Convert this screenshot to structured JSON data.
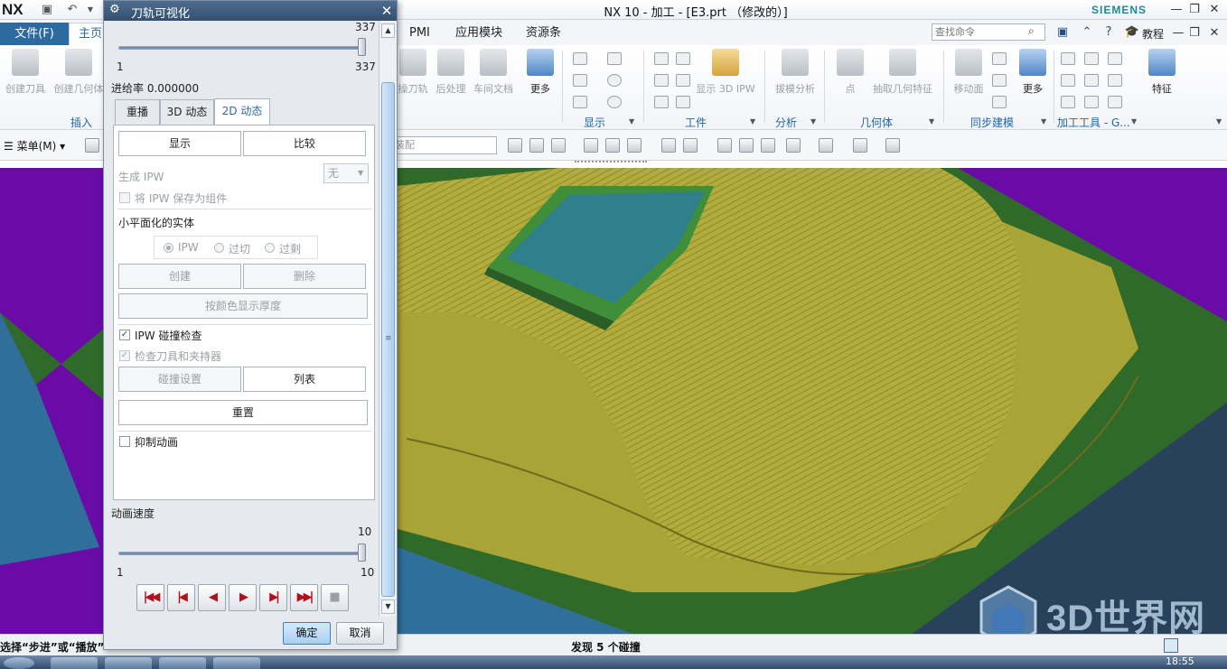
{
  "titlebar": {
    "logo": "NX",
    "title": "NX 10 - 加工 - [E3.prt （修改的）]",
    "brand": "SIEMENS",
    "window_controls": [
      "minimize-icon",
      "restore-icon",
      "close-icon"
    ]
  },
  "ribbon": {
    "file_tab": "文件(F)",
    "home_tab": "主页",
    "tabs": [
      "PMI",
      "应用模块",
      "资源条"
    ],
    "search_placeholder": "查找命令",
    "tutorial": "教程",
    "buttons": {
      "create_tool": "创建刀具",
      "create_geometry": "创建几何体",
      "tool_path": "操刀轨",
      "post_process": "后处理",
      "shop_doc": "车间文档",
      "more1": "更多",
      "show_3d_ipw": "显示 3D IPW",
      "draft_analysis": "拔模分析",
      "point": "点",
      "extract_geometry": "抽取几何特征",
      "move_face": "移动面",
      "more2": "更多",
      "feature": "特征"
    },
    "groups": {
      "insert": "插入",
      "display": "显示",
      "workpiece": "工件",
      "analysis": "分析",
      "geometry": "几何体",
      "sync_modeling": "同步建模",
      "machining_tools": "加工工具 - G..."
    }
  },
  "toolbar2": {
    "menu": "菜单(M)",
    "assembly_placeholder": "装配"
  },
  "dialog": {
    "title": "刀轨可视化",
    "motion_slider": {
      "max_label": "337",
      "min_label": "1",
      "max_right": "337",
      "value_fraction": 1.0
    },
    "feed_rate": "进给率 0.000000",
    "tabs": [
      {
        "label": "重播",
        "active": false
      },
      {
        "label": "3D 动态",
        "active": false
      },
      {
        "label": "2D 动态",
        "active": true
      }
    ],
    "show_button": "显示",
    "compare_button": "比较",
    "generate_ipw_label": "生成 IPW",
    "generate_ipw_value": "无",
    "save_ipw_component": "将 IPW 保存为组件",
    "faceted_solid_heading": "小平面化的实体",
    "radios": [
      {
        "label": "IPW",
        "selected": true
      },
      {
        "label": "过切",
        "selected": false
      },
      {
        "label": "过剩",
        "selected": false
      }
    ],
    "create_button": "创建",
    "delete_button": "删除",
    "thickness_button": "按颜色显示厚度",
    "ipw_collision_check": "IPW 碰撞检查",
    "check_tool_holder": "检查刀具和夹持器",
    "collision_settings_button": "碰撞设置",
    "list_button": "列表",
    "reset_button": "重置",
    "suppress_animation": "抑制动画",
    "speed_label": "动画速度",
    "speed_slider": {
      "max_label": "10",
      "min_label": "1",
      "max_right": "10",
      "value_fraction": 1.0
    },
    "playback": [
      {
        "name": "go-start",
        "glyph": "|◀◀"
      },
      {
        "name": "step-back",
        "glyph": "|◀"
      },
      {
        "name": "play-backward",
        "glyph": "◀"
      },
      {
        "name": "play-forward",
        "glyph": "▶"
      },
      {
        "name": "step-forward",
        "glyph": "▶|"
      },
      {
        "name": "go-end",
        "glyph": "▶▶|"
      },
      {
        "name": "stop",
        "glyph": "■"
      }
    ],
    "ok_button": "确定",
    "cancel_button": "取消"
  },
  "status": {
    "left": "选择“步进”或“播放”",
    "middle": "发现 5 个碰撞"
  },
  "watermark": "3D世界网",
  "taskbar": {
    "clock": "18:55"
  },
  "colors": {
    "viewport_background": "#6a0ba8",
    "part_yellow": "#a9a436",
    "base_green": "#2f6a2a",
    "side_blue": "#2f6f9a",
    "pocket_green": "#3f8f3a",
    "accent_blue": "#2d6a9f"
  }
}
